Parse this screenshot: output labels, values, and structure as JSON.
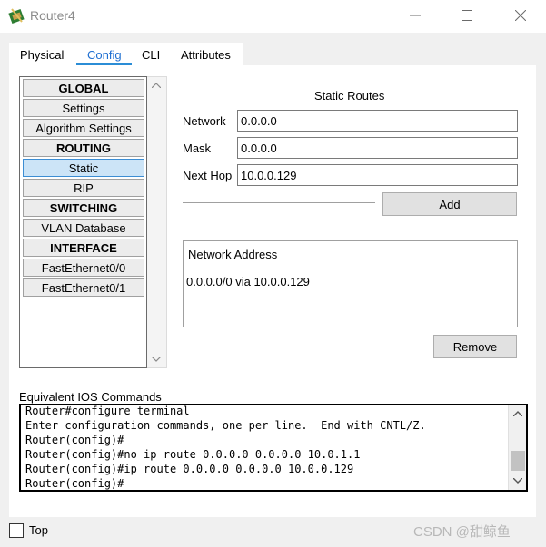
{
  "window": {
    "title": "Router4",
    "minimize_glyph": "—",
    "maximize_glyph": "☐",
    "close_glyph": "✕"
  },
  "tabs": [
    {
      "label": "Physical"
    },
    {
      "label": "Config"
    },
    {
      "label": "CLI"
    },
    {
      "label": "Attributes"
    }
  ],
  "active_tab": "Config",
  "sidebar": {
    "items": [
      {
        "label": "GLOBAL",
        "kind": "header"
      },
      {
        "label": "Settings",
        "kind": "item"
      },
      {
        "label": "Algorithm Settings",
        "kind": "item"
      },
      {
        "label": "ROUTING",
        "kind": "header"
      },
      {
        "label": "Static",
        "kind": "item",
        "selected": true
      },
      {
        "label": "RIP",
        "kind": "item"
      },
      {
        "label": "SWITCHING",
        "kind": "header"
      },
      {
        "label": "VLAN Database",
        "kind": "item"
      },
      {
        "label": "INTERFACE",
        "kind": "header"
      },
      {
        "label": "FastEthernet0/0",
        "kind": "item"
      },
      {
        "label": "FastEthernet0/1",
        "kind": "item"
      }
    ]
  },
  "static_routes": {
    "title": "Static Routes",
    "network_label": "Network",
    "network_value": "0.0.0.0",
    "mask_label": "Mask",
    "mask_value": "0.0.0.0",
    "next_hop_label": "Next Hop",
    "next_hop_value": "10.0.0.129",
    "add_button": "Add",
    "list_header": "Network Address",
    "entries": [
      "0.0.0.0/0 via 10.0.0.129"
    ],
    "remove_button": "Remove"
  },
  "ios": {
    "label": "Equivalent IOS Commands",
    "lines": [
      "Router#configure terminal",
      "Enter configuration commands, one per line.  End with CNTL/Z.",
      "Router(config)#",
      "Router(config)#no ip route 0.0.0.0 0.0.0.0 10.0.1.1",
      "Router(config)#ip route 0.0.0.0 0.0.0.0 10.0.0.129",
      "Router(config)#"
    ]
  },
  "footer": {
    "top_label": "Top",
    "watermark": "CSDN @甜鲸鱼"
  },
  "colors": {
    "active_tab": "#1f6fd1",
    "selected_item_bg": "#cce4f7"
  }
}
